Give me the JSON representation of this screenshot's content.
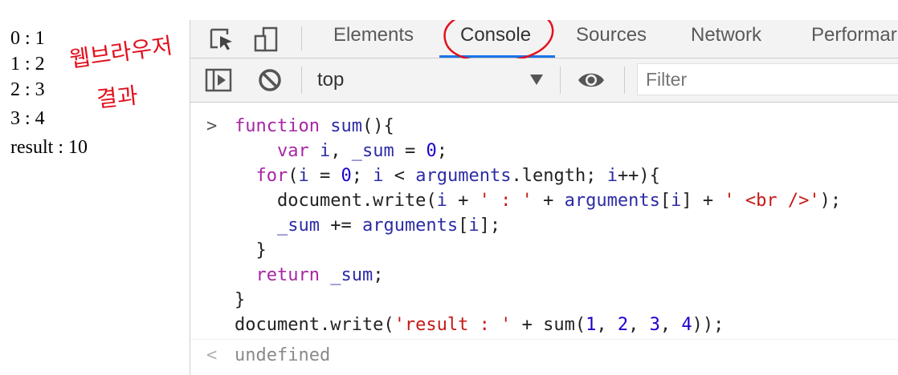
{
  "output": {
    "lines": [
      "0 : 1",
      "1 : 2",
      "2 : 3",
      "3 : 4",
      "result : 10"
    ],
    "annotation_line1": "웹브라우저",
    "annotation_line2": "결과"
  },
  "tabs": [
    {
      "label": "Elements"
    },
    {
      "label": "Console"
    },
    {
      "label": "Sources"
    },
    {
      "label": "Network"
    },
    {
      "label": "Performar"
    }
  ],
  "toolbar": {
    "context": "top",
    "filter_placeholder": "Filter"
  },
  "console": {
    "input_prompt": ">",
    "result_prompt": "<",
    "result": "undefined"
  },
  "icons": [
    "inspect-element-icon",
    "device-toolbar-icon",
    "sidebar-toggle-icon",
    "clear-console-icon",
    "eye-icon",
    "dropdown-arrow-icon"
  ],
  "colors": {
    "accent": "#1a73e8",
    "annotation": "#e3101e",
    "keyword": "#a626a4",
    "string": "#c41a16",
    "number": "#1c00cf"
  }
}
